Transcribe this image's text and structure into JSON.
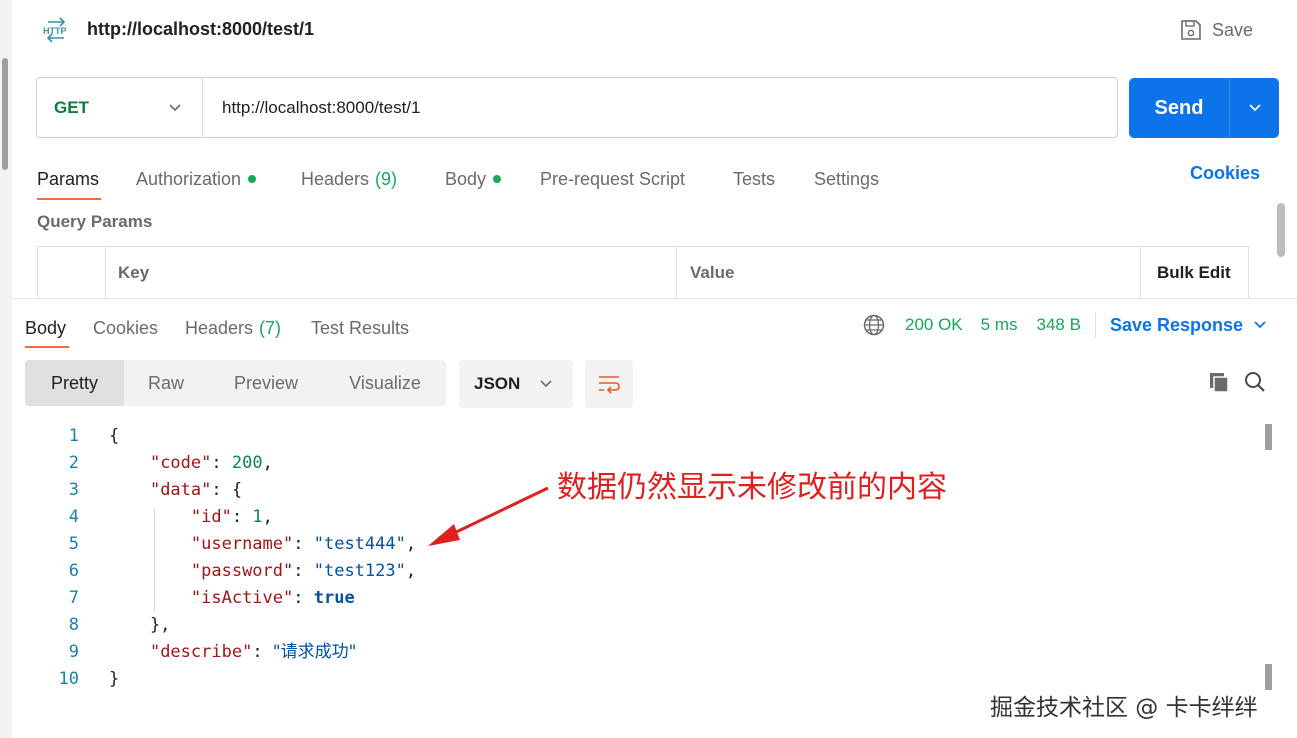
{
  "topbar": {
    "title": "http://localhost:8000/test/1",
    "save_label": "Save",
    "http_icon_label": "HTTP"
  },
  "request": {
    "method": "GET",
    "url": "http://localhost:8000/test/1",
    "send_label": "Send",
    "method_color": "#0b7d3e",
    "send_color": "#0c74e8"
  },
  "request_tabs": {
    "params": "Params",
    "authorization": "Authorization",
    "headers": "Headers",
    "headers_count": "(9)",
    "body": "Body",
    "prerequest": "Pre-request Script",
    "tests": "Tests",
    "settings": "Settings",
    "cookies": "Cookies"
  },
  "query_params": {
    "title": "Query Params",
    "columns": [
      "Key",
      "Value",
      "Bulk Edit"
    ]
  },
  "response_tabs": {
    "body": "Body",
    "cookies": "Cookies",
    "headers": "Headers",
    "headers_count": "(7)",
    "test_results": "Test Results"
  },
  "response_status": {
    "code": "200 OK",
    "time": "5 ms",
    "size": "348 B",
    "save_response": "Save Response"
  },
  "format": {
    "options": [
      "Pretty",
      "Raw",
      "Preview",
      "Visualize"
    ],
    "active": "Pretty",
    "language": "JSON"
  },
  "code": {
    "line_numbers": [
      "1",
      "2",
      "3",
      "4",
      "5",
      "6",
      "7",
      "8",
      "9",
      "10"
    ],
    "l1": "{",
    "code_key": "\"code\"",
    "code_val": "200",
    "data_key": "\"data\"",
    "id_key": "\"id\"",
    "id_val": "1",
    "username_key": "\"username\"",
    "username_val": "\"test444\"",
    "password_key": "\"password\"",
    "password_val": "\"test123\"",
    "isactive_key": "\"isActive\"",
    "isactive_val": "true",
    "describe_key": "\"describe\"",
    "describe_val": "\"请求成功\"",
    "l10": "}"
  },
  "annotation": {
    "text": "数据仍然显示未修改前的内容",
    "color": "#e02020"
  },
  "watermark": "掘金技术社区 @ 卡卡绊绊"
}
